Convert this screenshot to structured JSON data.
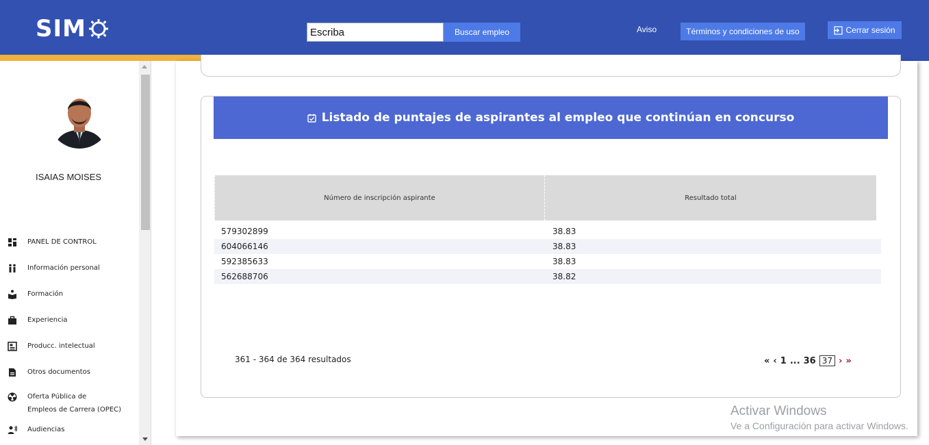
{
  "header": {
    "logo_text": "SIM",
    "search": {
      "value": "Escriba"
    },
    "search_button": "Buscar empleo",
    "aviso": "Aviso",
    "terms_button": "Términos y condiciones de uso",
    "logout_button": "Cerrar sesión"
  },
  "colors": {
    "header_bg": "#3251b0",
    "stripe_yellow": "#f0b23c",
    "stripe_red": "#d9414f",
    "banner_bg": "#4d68d2",
    "button_bg": "#4d7ae6"
  },
  "sidebar": {
    "user_name": "ISAIAS MOISES",
    "items": [
      {
        "label": "PANEL DE CONTROL",
        "icon": "dashboard-icon"
      },
      {
        "label": "Información personal",
        "icon": "people-icon"
      },
      {
        "label": "Formación",
        "icon": "book-reader-icon"
      },
      {
        "label": "Experiencia",
        "icon": "briefcase-icon"
      },
      {
        "label": "Producc. intelectual",
        "icon": "newspaper-icon"
      },
      {
        "label": "Otros documentos",
        "icon": "document-icon"
      },
      {
        "label": "Oferta Pública de",
        "label2": "Empleos de Carrera (OPEC)",
        "icon": "radiation-icon"
      },
      {
        "label": "Audiencias",
        "icon": "speaker-icon"
      }
    ]
  },
  "main": {
    "banner_title": "Listado de puntajes de aspirantes al empleo que continúan en concurso",
    "table": {
      "headers": [
        "Número de inscripción aspirante",
        "Resultado total"
      ],
      "rows": [
        [
          "579302899",
          "38.83"
        ],
        [
          "604066146",
          "38.83"
        ],
        [
          "592385633",
          "38.83"
        ],
        [
          "562688706",
          "38.82"
        ]
      ]
    },
    "results_text": "361 - 364 de 364 resultados",
    "pagination": {
      "first": "«",
      "prev": "‹",
      "page_first": "1",
      "ellipsis": "...",
      "page_prev": "36",
      "current": "37",
      "next": "›",
      "last": "»"
    }
  },
  "watermark": {
    "line1": "Activar Windows",
    "line2": "Ve a Configuración para activar Windows."
  }
}
